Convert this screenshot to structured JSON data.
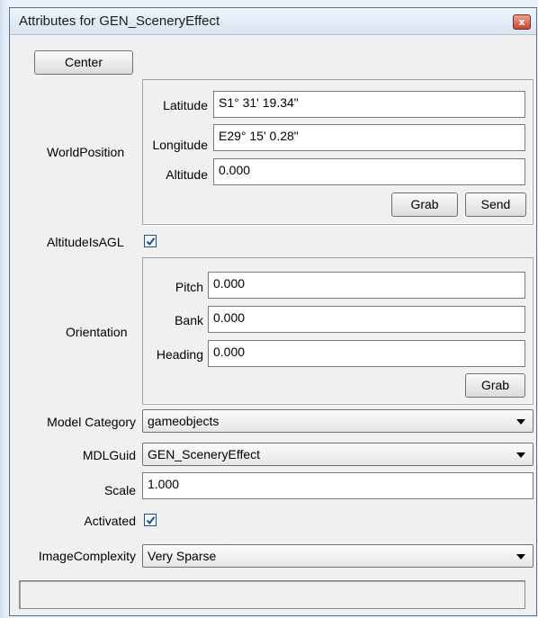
{
  "window": {
    "title": "Attributes for GEN_SceneryEffect",
    "close_glyph": "x"
  },
  "center_button": "Center",
  "world_position": {
    "label": "WorldPosition",
    "latitude_label": "Latitude",
    "latitude_value": "S1° 31' 19.34\"",
    "longitude_label": "Longitude",
    "longitude_value": "E29° 15' 0.28\"",
    "altitude_label": "Altitude",
    "altitude_value": "0.000",
    "grab_label": "Grab",
    "send_label": "Send"
  },
  "altitude_is_agl": {
    "label": "AltitudeIsAGL",
    "checked": true
  },
  "orientation": {
    "label": "Orientation",
    "pitch_label": "Pitch",
    "pitch_value": "0.000",
    "bank_label": "Bank",
    "bank_value": "0.000",
    "heading_label": "Heading",
    "heading_value": "0.000",
    "grab_label": "Grab"
  },
  "model_category": {
    "label": "Model Category",
    "value": "gameobjects"
  },
  "mdl_guid": {
    "label": "MDLGuid",
    "value": "GEN_SceneryEffect"
  },
  "scale": {
    "label": "Scale",
    "value": "1.000"
  },
  "activated": {
    "label": "Activated",
    "checked": true
  },
  "image_complexity": {
    "label": "ImageComplexity",
    "value": "Very Sparse"
  },
  "status_bar": {
    "text": ""
  },
  "icons": {
    "close": "close-icon",
    "checkmark": "checkmark-icon",
    "dropdown": "chevron-down-icon"
  },
  "colors": {
    "checkbox_check": "#1c4f8a",
    "close_button": "#c7452c"
  }
}
